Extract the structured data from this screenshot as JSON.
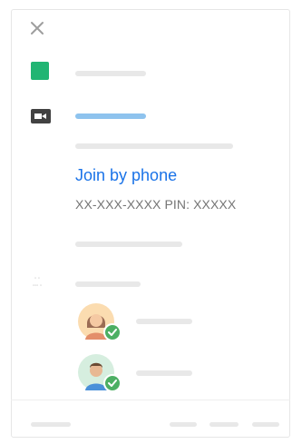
{
  "dialog": {
    "close_icon": "close-icon",
    "color_icon": "color-square-icon",
    "color_hex": "#21b573",
    "video_icon": "video-camera-icon",
    "join_by_phone_label": "Join by phone",
    "phone_and_pin": "XX-XXX-XXXX PIN: XXXXX",
    "accent_color": "#1a73e8"
  },
  "guests": [
    {
      "avatar_icon": "woman-avatar-icon",
      "status_icon": "check-icon"
    },
    {
      "avatar_icon": "man-avatar-icon",
      "status_icon": "check-icon"
    }
  ]
}
